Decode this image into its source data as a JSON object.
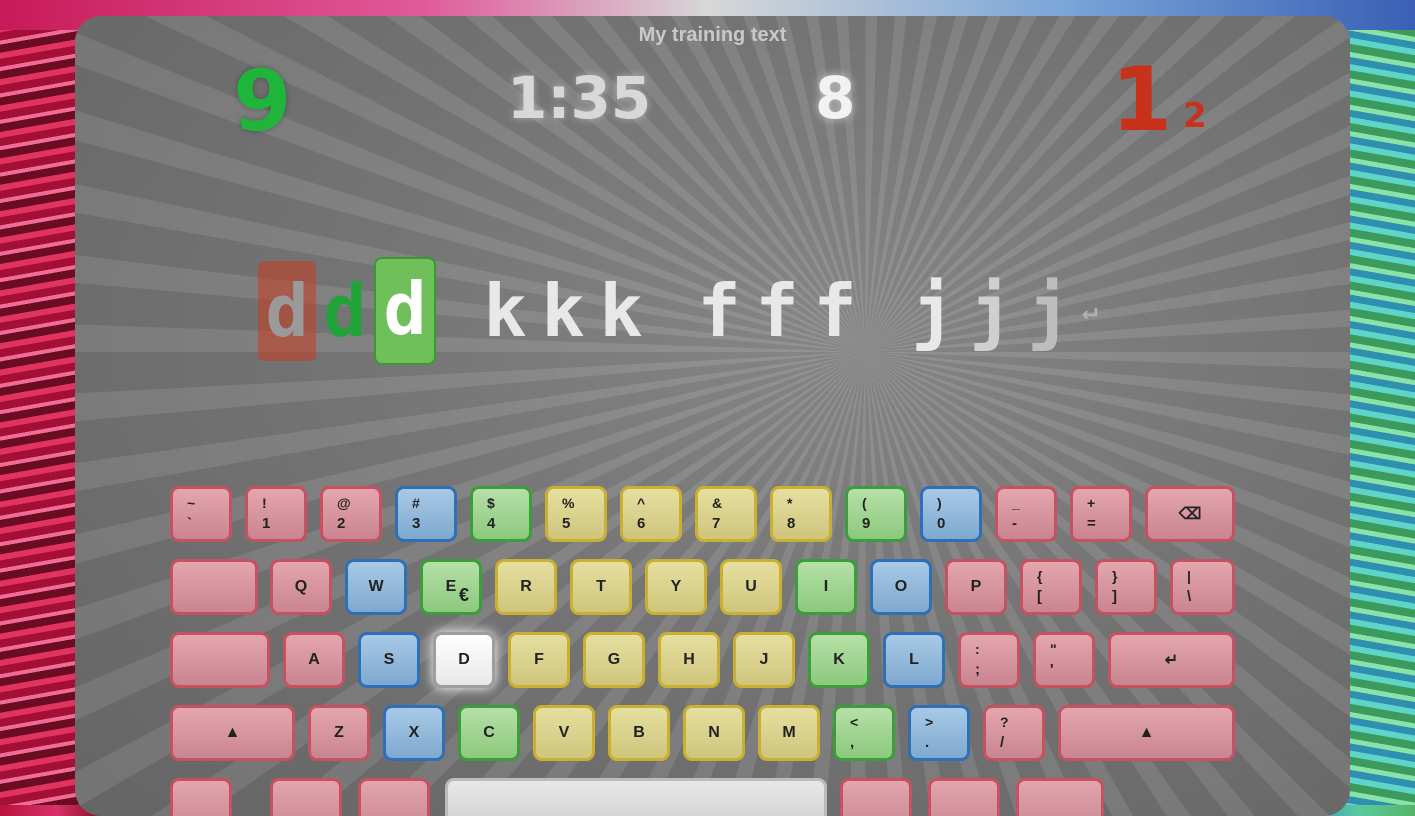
{
  "title": "My training text",
  "stats": {
    "correct": "9",
    "time": "1:35",
    "speed": "8",
    "errors": "1",
    "errors_sub": "2"
  },
  "training_line": {
    "chars": [
      "d",
      "d",
      "d",
      " ",
      "k",
      "k",
      "k",
      " ",
      "f",
      "f",
      "f",
      " ",
      "j",
      "j",
      "j"
    ],
    "enter_symbol": "↵"
  },
  "keyboard": {
    "row1": [
      {
        "top": "~",
        "bot": "`"
      },
      {
        "top": "!",
        "bot": "1"
      },
      {
        "top": "@",
        "bot": "2"
      },
      {
        "top": "#",
        "bot": "3"
      },
      {
        "top": "$",
        "bot": "4"
      },
      {
        "top": "%",
        "bot": "5"
      },
      {
        "top": "^",
        "bot": "6"
      },
      {
        "top": "&",
        "bot": "7"
      },
      {
        "top": "*",
        "bot": "8"
      },
      {
        "top": "(",
        "bot": "9"
      },
      {
        "top": ")",
        "bot": "0"
      },
      {
        "top": "_",
        "bot": "-"
      },
      {
        "top": "+",
        "bot": "="
      },
      {
        "label": "⌫"
      }
    ],
    "row2": [
      {
        "label": ""
      },
      {
        "label": "Q"
      },
      {
        "label": "W"
      },
      {
        "label": "E",
        "extra": "€"
      },
      {
        "label": "R"
      },
      {
        "label": "T"
      },
      {
        "label": "Y"
      },
      {
        "label": "U"
      },
      {
        "label": "I"
      },
      {
        "label": "O"
      },
      {
        "label": "P"
      },
      {
        "top": "{",
        "bot": "["
      },
      {
        "top": "}",
        "bot": "]"
      },
      {
        "top": "|",
        "bot": "\\"
      }
    ],
    "row3": [
      {
        "label": ""
      },
      {
        "label": "A"
      },
      {
        "label": "S"
      },
      {
        "label": "D"
      },
      {
        "label": "F"
      },
      {
        "label": "G"
      },
      {
        "label": "H"
      },
      {
        "label": "J"
      },
      {
        "label": "K"
      },
      {
        "label": "L"
      },
      {
        "top": ":",
        "bot": ";"
      },
      {
        "top": "\"",
        "bot": "'"
      },
      {
        "label": "↵"
      }
    ],
    "row4": [
      {
        "label": "▲"
      },
      {
        "label": "Z"
      },
      {
        "label": "X"
      },
      {
        "label": "C"
      },
      {
        "label": "V"
      },
      {
        "label": "B"
      },
      {
        "label": "N"
      },
      {
        "label": "M"
      },
      {
        "top": "<",
        "bot": ","
      },
      {
        "top": ">",
        "bot": "."
      },
      {
        "top": "?",
        "bot": "/"
      },
      {
        "label": "▲"
      }
    ]
  },
  "colors": {
    "correct": "#1fb53a",
    "error": "#c8321a",
    "current_key": "#ffffff"
  }
}
